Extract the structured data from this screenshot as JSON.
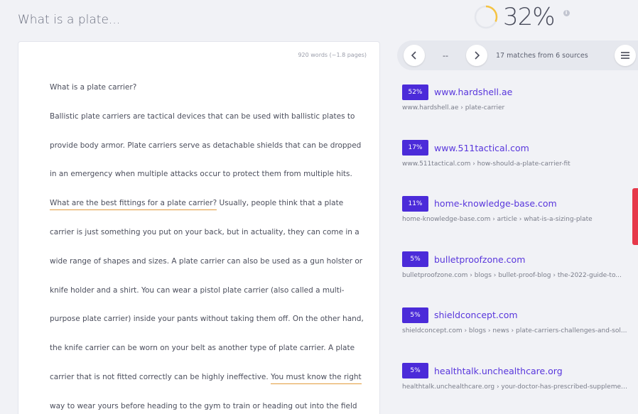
{
  "document": {
    "title": "What is a plate...",
    "word_count": "920 words (~1.8 pages)",
    "lines": [
      [
        {
          "t": "What is a plate carrier?",
          "hl": false
        }
      ],
      [
        {
          "t": "Ballistic plate carriers are tactical devices that can be used with ballistic plates to",
          "hl": false
        }
      ],
      [
        {
          "t": "provide body armor. Plate carriers serve as detachable shields that can be dropped",
          "hl": false
        }
      ],
      [
        {
          "t": "in an emergency when multiple attacks occur to protect them from multiple hits.",
          "hl": false
        }
      ],
      [
        {
          "t": "What are the best fittings for a plate carrier?",
          "hl": true
        },
        {
          "t": " Usually, people think that a plate",
          "hl": false
        }
      ],
      [
        {
          "t": "carrier is just something you put on your back, but in actuality, they can come in a",
          "hl": false
        }
      ],
      [
        {
          "t": "wide range of shapes and sizes. A plate carrier can also be used as a gun holster or",
          "hl": false
        }
      ],
      [
        {
          "t": "knife holder and a shirt. You can wear a pistol plate carrier (also called a multi-",
          "hl": false
        }
      ],
      [
        {
          "t": "purpose plate carrier) inside your pants without taking them off. On the other hand,",
          "hl": false
        }
      ],
      [
        {
          "t": "the knife carrier can be worn on your belt as another type of plate carrier. A plate",
          "hl": false
        }
      ],
      [
        {
          "t": "carrier that is not fitted correctly can be highly ineffective. ",
          "hl": false
        },
        {
          "t": "You must know the right",
          "hl": true
        }
      ],
      [
        {
          "t": "way to wear yours before heading to the gym to train or heading out into the field",
          "hl": false
        }
      ]
    ]
  },
  "score": {
    "value": "32%",
    "fraction": 0.32,
    "ring_color": "#f5c342",
    "track_color": "#e4e6ec"
  },
  "toolbar": {
    "prev_icon": "chevron-left-icon",
    "next_icon": "chevron-right-icon",
    "pager_value": "--",
    "matches_text": "17 matches from 6 sources",
    "menu_icon": "hamburger-menu-icon"
  },
  "colors": {
    "badge": "#4b2bd9",
    "link": "#5836dc",
    "highlight_underline": "#e39b3c",
    "side_tab": "#e6394a"
  },
  "sources": [
    {
      "percent": "52%",
      "site": "www.hardshell.ae",
      "path": "www.hardshell.ae › plate-carrier"
    },
    {
      "percent": "17%",
      "site": "www.511tactical.com",
      "path": "www.511tactical.com › how-should-a-plate-carrier-fit"
    },
    {
      "percent": "11%",
      "site": "home-knowledge-base.com",
      "path": "home-knowledge-base.com › article › what-is-a-sizing-plate"
    },
    {
      "percent": "5%",
      "site": "bulletproofzone.com",
      "path": "bulletproofzone.com › blogs › bullet-proof-blog › the-2022-guide-to..."
    },
    {
      "percent": "5%",
      "site": "shieldconcept.com",
      "path": "shieldconcept.com › blogs › news › plate-carriers-challenges-and-sol..."
    },
    {
      "percent": "5%",
      "site": "healthtalk.unchealthcare.org",
      "path": "healthtalk.unchealthcare.org › your-doctor-has-prescribed-supplemen..."
    }
  ]
}
